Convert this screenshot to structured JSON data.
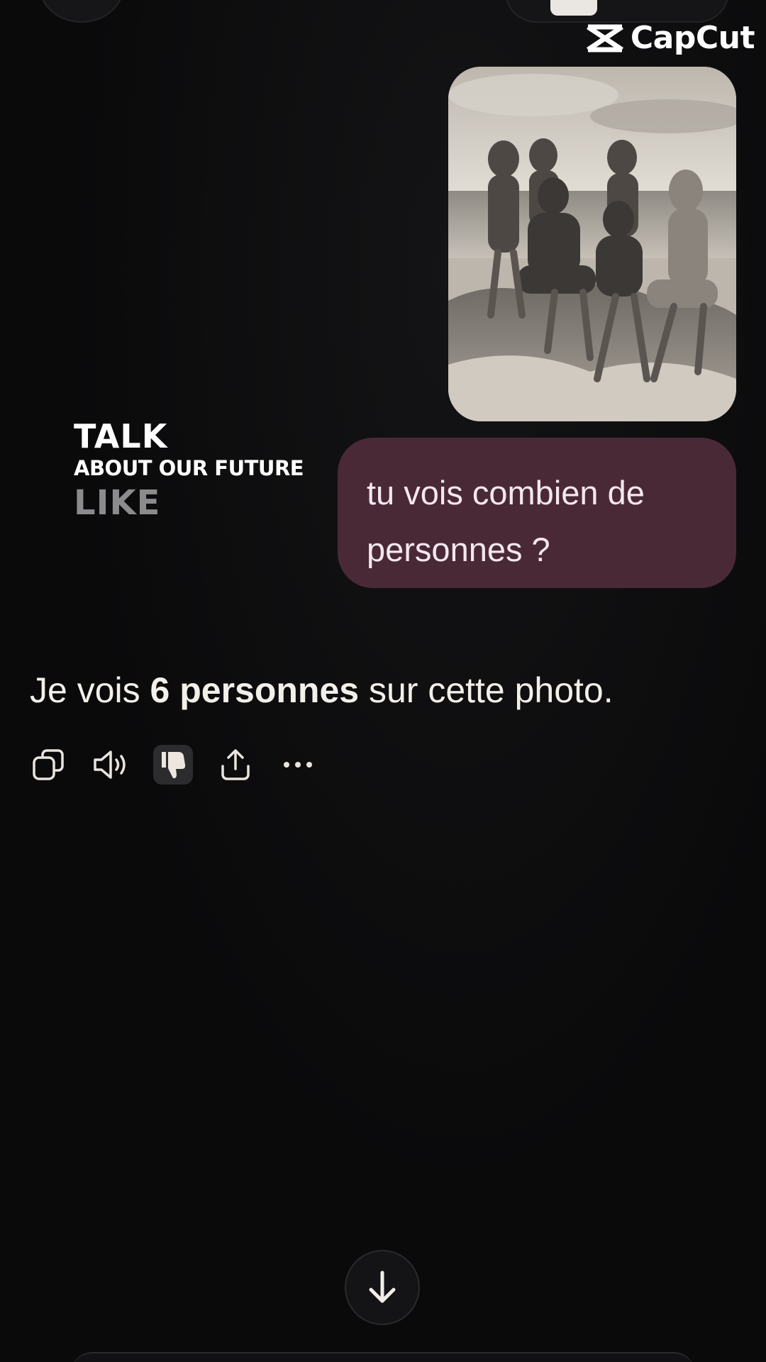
{
  "watermark": {
    "brand": "CapCut"
  },
  "overlay": {
    "line1": "TALK",
    "line2": "ABOUT OUR FUTURE",
    "line3": "LIKE"
  },
  "user_message": {
    "text": "tu vois combien de personnes ?"
  },
  "assistant_message": {
    "prefix": "Je vois ",
    "bold": "6 personnes",
    "suffix": " sur cette photo."
  },
  "actions": [
    {
      "icon": "copy-icon"
    },
    {
      "icon": "speaker-icon"
    },
    {
      "icon": "thumbs-down-icon",
      "active": true
    },
    {
      "icon": "share-icon"
    },
    {
      "icon": "more-icon"
    }
  ],
  "colors": {
    "background": "#0a0a0b",
    "bubble": "#4a2937",
    "text": "#f3efe9"
  }
}
